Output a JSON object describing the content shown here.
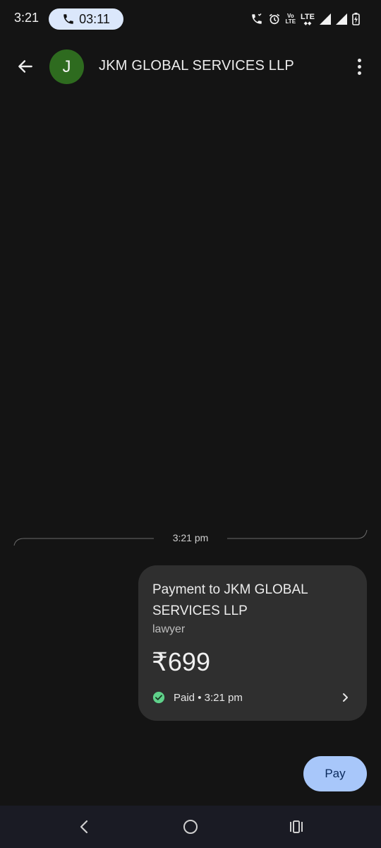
{
  "status_bar": {
    "time": "3:21",
    "call_timer": "03:11",
    "volte_top": "Vo",
    "volte_bottom": "LTE",
    "lte": "LTE"
  },
  "header": {
    "avatar_initial": "J",
    "contact_name": "JKM GLOBAL SERVICES LLP",
    "avatar_color": "#2e6b1f"
  },
  "conversation": {
    "timestamp": "3:21 pm",
    "payment": {
      "title": "Payment to JKM GLOBAL SERVICES LLP",
      "note": "lawyer",
      "amount": "₹699",
      "status": "Paid • 3:21 pm",
      "status_color": "#5fd18a"
    }
  },
  "actions": {
    "pay_label": "Pay",
    "pay_color": "#a8c7fa"
  },
  "nav": {
    "back_icon": "nav-back-icon",
    "home_icon": "nav-home-icon",
    "recents_icon": "nav-recents-icon"
  }
}
